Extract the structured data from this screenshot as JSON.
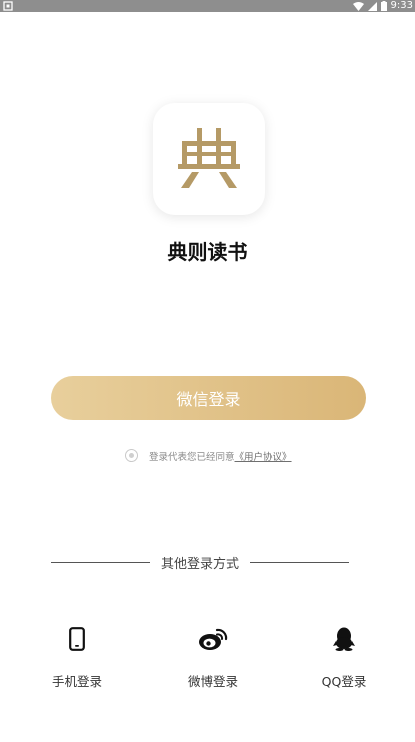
{
  "status_bar": {
    "time": "9:33"
  },
  "app": {
    "icon_glyph": "典",
    "name": "典则读书",
    "brand_color": "#b59a66"
  },
  "login": {
    "wechat_button": "微信登录",
    "agreement_prefix": "登录代表您已经同意",
    "agreement_link": "《用户协议》"
  },
  "other_login": {
    "title": "其他登录方式",
    "items": [
      {
        "label": "手机登录",
        "icon": "phone-icon"
      },
      {
        "label": "微博登录",
        "icon": "weibo-icon"
      },
      {
        "label": "QQ登录",
        "icon": "qq-icon"
      }
    ]
  }
}
